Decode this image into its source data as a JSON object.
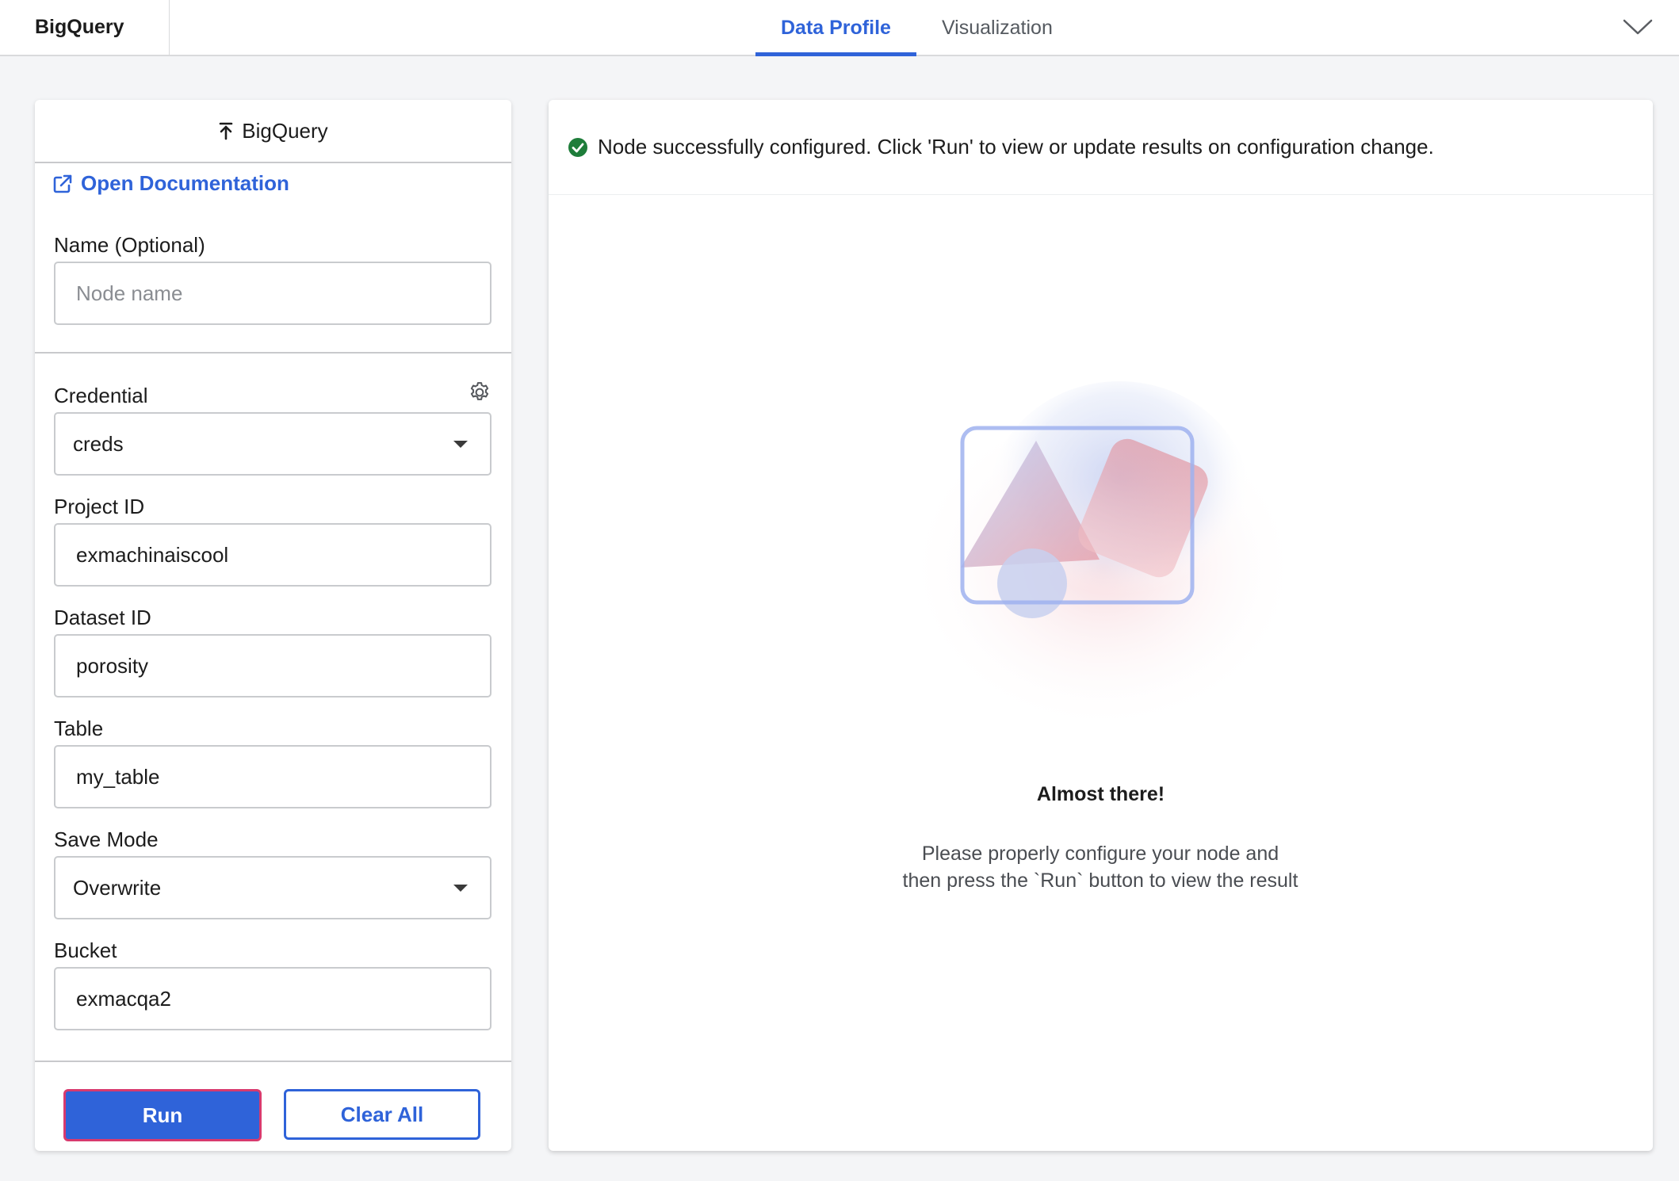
{
  "app": {
    "title": "BigQuery"
  },
  "tabs": [
    {
      "label": "Data Profile",
      "active": true
    },
    {
      "label": "Visualization",
      "active": false
    }
  ],
  "left_panel": {
    "header_title": "BigQuery",
    "doc_link": "Open Documentation",
    "name": {
      "label": "Name (Optional)",
      "placeholder": "Node name",
      "value": ""
    },
    "credential": {
      "label": "Credential",
      "value": "creds"
    },
    "project_id": {
      "label": "Project ID",
      "value": "exmachinaiscool"
    },
    "dataset_id": {
      "label": "Dataset ID",
      "value": "porosity"
    },
    "table": {
      "label": "Table",
      "value": "my_table"
    },
    "save_mode": {
      "label": "Save Mode",
      "value": "Overwrite"
    },
    "bucket": {
      "label": "Bucket",
      "value": "exmacqa2"
    },
    "run_label": "Run",
    "clear_label": "Clear All"
  },
  "right_panel": {
    "status_message": "Node successfully configured. Click 'Run' to view or update results on configuration change.",
    "empty_title": "Almost there!",
    "empty_text": "Please properly configure your node and then press the `Run` button to view the result"
  },
  "colors": {
    "accent": "#2f63d9",
    "success": "#1e7d3a",
    "run_border": "#d83a6e"
  },
  "icons": {
    "collapse": "chevron-down-icon",
    "header": "upload-arrow-icon",
    "doc_link": "external-link-icon",
    "credential": "gear-icon",
    "select": "caret-down-icon",
    "status": "check-circle-icon",
    "empty_state": "empty-state-illustration"
  }
}
